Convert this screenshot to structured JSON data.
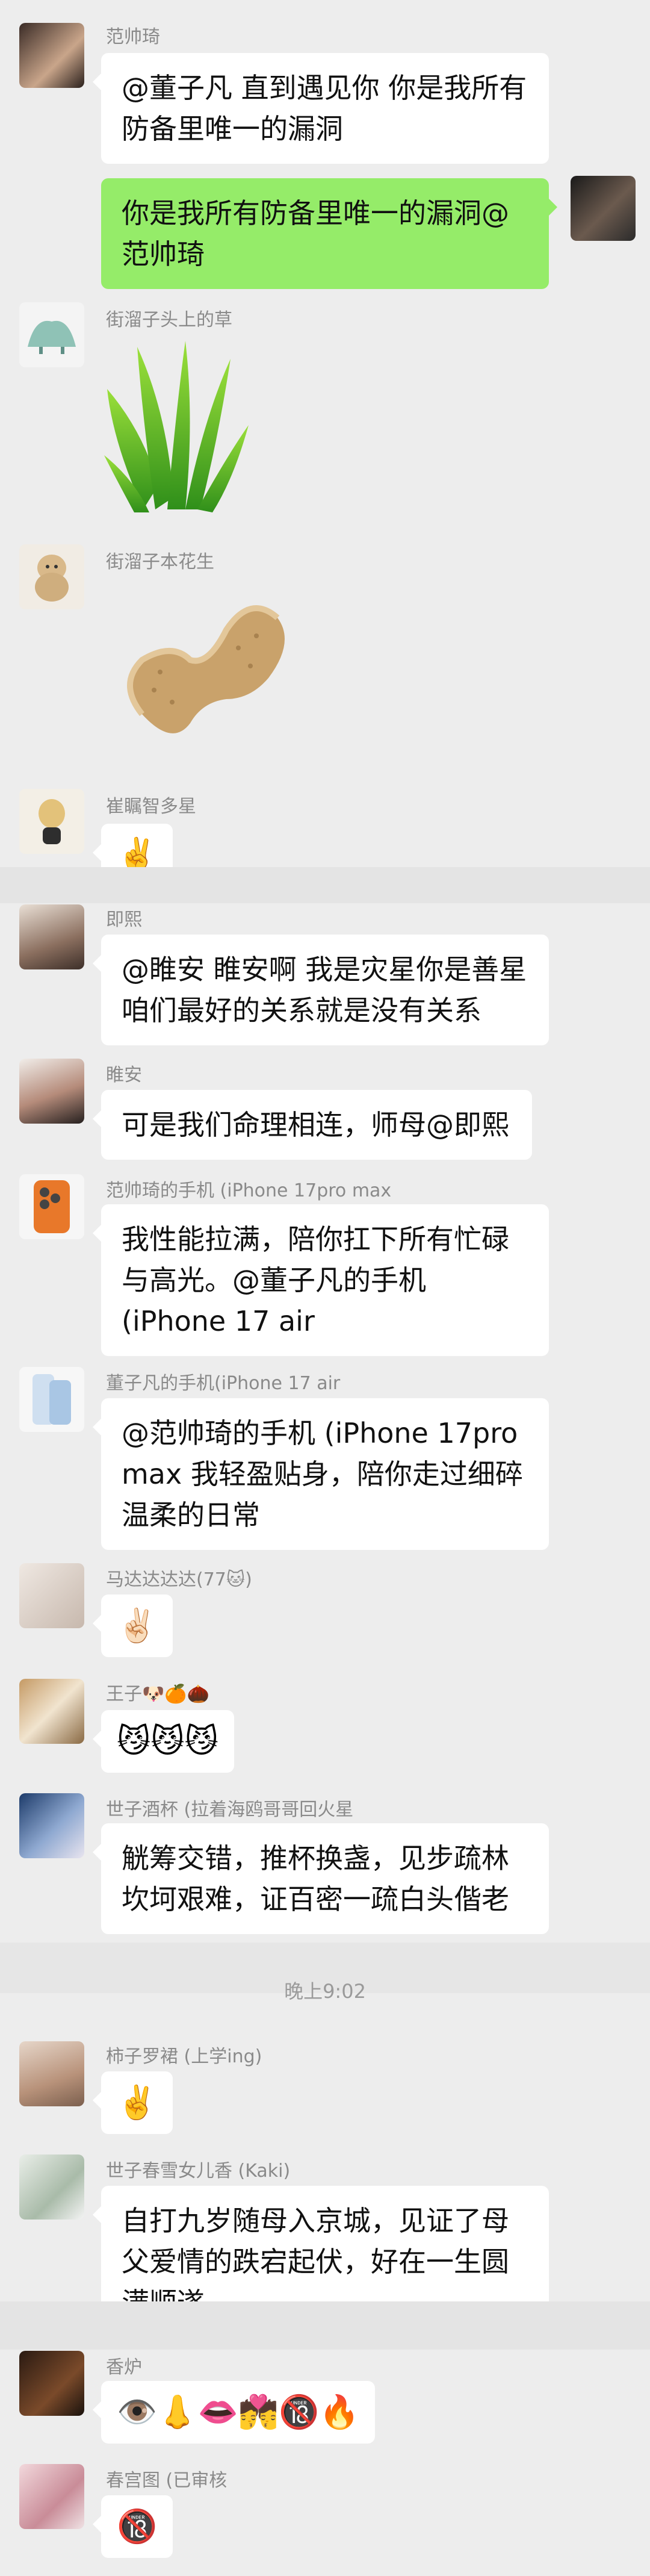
{
  "messages": {
    "m1": {
      "sender": "范帅琦",
      "text": "@董子凡  直到遇见你 你是我所有防备里唯一的漏洞"
    },
    "m2": {
      "text": "你是我所有防备里唯一的漏洞@范帅琦"
    },
    "m3": {
      "sender": "街溜子头上的草"
    },
    "m4": {
      "sender": "街溜子本花生"
    },
    "m5": {
      "sender": "崔瞩智多星",
      "emoji": "✌️"
    },
    "m6": {
      "sender": "即熙",
      "text": "@睢安  睢安啊 我是灾星你是善星咱们最好的关系就是没有关系"
    },
    "m7": {
      "sender": "睢安",
      "text": "可是我们命理相连，师母@即熙"
    },
    "m8": {
      "sender": "范帅琦的手机 (iPhone 17pro max",
      "text": "我性能拉满，陪你扛下所有忙碌与高光。@董子凡的手机(iPhone 17 air"
    },
    "m9": {
      "sender": "董子凡的手机(iPhone 17 air",
      "text": "@范帅琦的手机 (iPhone 17pro max  我轻盈贴身，陪你走过细碎温柔的日常"
    },
    "m10": {
      "sender": "马达达达达(77🐱)",
      "emoji": "✌🏻"
    },
    "m11": {
      "sender": "王子🐶🍊🌰",
      "emoji": "😼😼😼"
    },
    "m12": {
      "sender": "世子酒杯 (拉着海鸥哥哥回火星",
      "text": "觥筹交错，推杯换盏，见步疏林坎坷艰难，证百密一疏白头偕老"
    },
    "time": "晚上9:02",
    "m13": {
      "sender": "柿子罗裙 (上学ing)",
      "emoji": "✌️"
    },
    "m14": {
      "sender": "世子春雪女儿香 (Kaki)",
      "text": "自打九岁随母入京城，见证了母父爱情的跌宕起伏，好在一生圆满顺遂"
    },
    "m15": {
      "sender": "香炉",
      "emoji": "👁️👃👄💏🔞🔥"
    },
    "m16": {
      "sender": "春宫图 (已审核",
      "emoji": "🔞"
    }
  },
  "colors": {
    "bg": "#ededed",
    "self_bubble": "#95ec69",
    "other_bubble": "#ffffff",
    "sender_name": "#8a8a8a"
  }
}
